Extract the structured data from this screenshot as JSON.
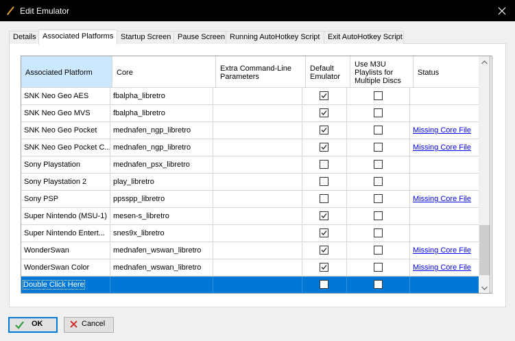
{
  "window": {
    "title": "Edit Emulator",
    "icon": "pencil-icon"
  },
  "tabs": [
    {
      "label": "Details",
      "active": false
    },
    {
      "label": "Associated Platforms",
      "active": true
    },
    {
      "label": "Startup Screen",
      "active": false
    },
    {
      "label": "Pause Screen",
      "active": false
    },
    {
      "label": "Running AutoHotkey Script",
      "active": false
    },
    {
      "label": "Exit AutoHotkey Script",
      "active": false
    }
  ],
  "grid": {
    "columns": [
      {
        "label": "Associated Platform",
        "selected": true
      },
      {
        "label": "Core",
        "selected": false
      },
      {
        "label": "Extra Command-Line Parameters",
        "selected": false
      },
      {
        "label": "Default Emulator",
        "selected": false
      },
      {
        "label": "Use M3U Playlists for Multiple Discs",
        "selected": false
      },
      {
        "label": "Status",
        "selected": false
      }
    ],
    "rows": [
      {
        "platform": "SNK Neo Geo AES",
        "core": "fbalpha_libretro",
        "params": "",
        "default": true,
        "m3u": false,
        "status": ""
      },
      {
        "platform": "SNK Neo Geo MVS",
        "core": "fbalpha_libretro",
        "params": "",
        "default": true,
        "m3u": false,
        "status": ""
      },
      {
        "platform": "SNK Neo Geo Pocket",
        "core": "mednafen_ngp_libretro",
        "params": "",
        "default": true,
        "m3u": false,
        "status": "Missing Core File"
      },
      {
        "platform": "SNK Neo Geo Pocket C...",
        "core": "mednafen_ngp_libretro",
        "params": "",
        "default": true,
        "m3u": false,
        "status": "Missing Core File"
      },
      {
        "platform": "Sony Playstation",
        "core": "mednafen_psx_libretro",
        "params": "",
        "default": false,
        "m3u": false,
        "status": ""
      },
      {
        "platform": "Sony Playstation 2",
        "core": "play_libretro",
        "params": "",
        "default": false,
        "m3u": false,
        "status": ""
      },
      {
        "platform": "Sony PSP",
        "core": "ppsspp_libretro",
        "params": "",
        "default": false,
        "m3u": false,
        "status": "Missing Core File"
      },
      {
        "platform": "Super Nintendo (MSU-1)",
        "core": "mesen-s_libretro",
        "params": "",
        "default": true,
        "m3u": false,
        "status": ""
      },
      {
        "platform": "Super Nintendo Entert...",
        "core": "snes9x_libretro",
        "params": "",
        "default": true,
        "m3u": false,
        "status": ""
      },
      {
        "platform": "WonderSwan",
        "core": "mednafen_wswan_libretro",
        "params": "",
        "default": true,
        "m3u": false,
        "status": "Missing Core File"
      },
      {
        "platform": "WonderSwan Color",
        "core": "mednafen_wswan_libretro",
        "params": "",
        "default": true,
        "m3u": false,
        "status": "Missing Core File"
      }
    ],
    "new_row": {
      "platform": "Double Click Here"
    }
  },
  "buttons": {
    "ok_label": "OK",
    "cancel_label": "Cancel"
  },
  "colors": {
    "selection": "#0078d7",
    "header_selected": "#cce8ff",
    "link": "#0000ee"
  }
}
